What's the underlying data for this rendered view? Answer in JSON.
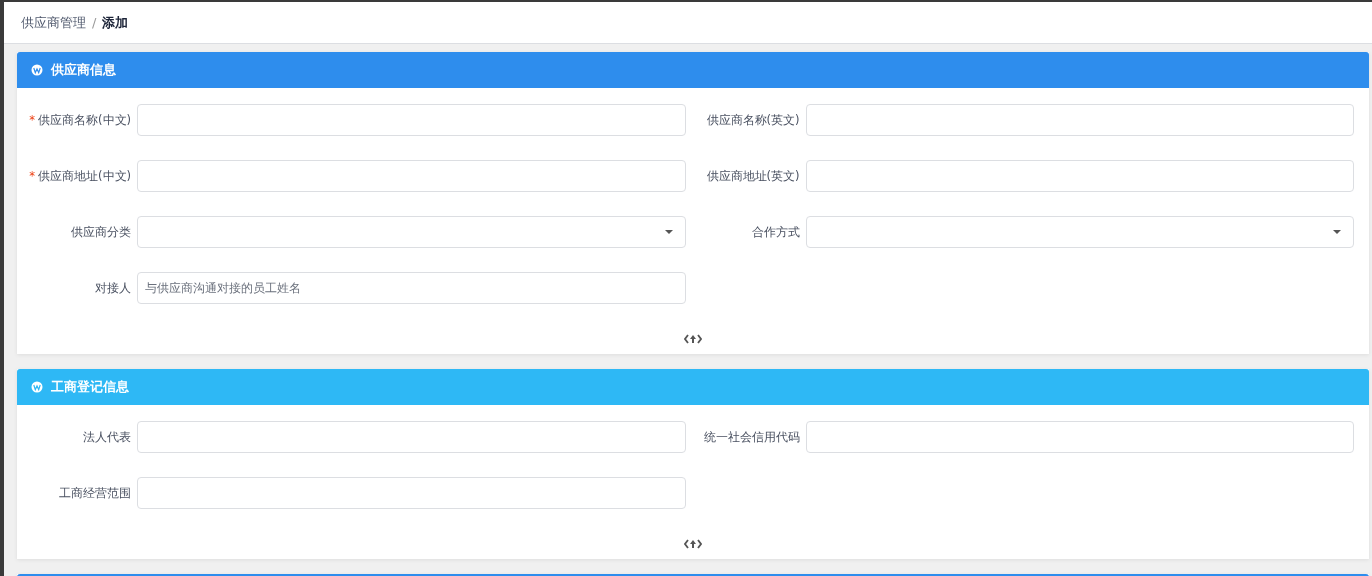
{
  "breadcrumb_separator": "/",
  "required_mark": "*",
  "breadcrumb": [
    {
      "label": "供应商管理",
      "current": false
    },
    {
      "label": "添加",
      "current": true
    }
  ],
  "sections": [
    {
      "title": "供应商信息",
      "color": "#2e8ded",
      "fields": [
        {
          "label": "供应商名称(中文)",
          "required": true,
          "kind": "text"
        },
        {
          "label": "供应商名称(英文)",
          "required": false,
          "kind": "text"
        },
        {
          "label": "供应商地址(中文)",
          "required": true,
          "kind": "text"
        },
        {
          "label": "供应商地址(英文)",
          "required": false,
          "kind": "text"
        },
        {
          "label": "供应商分类",
          "required": false,
          "kind": "select"
        },
        {
          "label": "合作方式",
          "required": false,
          "kind": "select"
        },
        {
          "label": "对接人",
          "required": false,
          "kind": "text",
          "placeholder": "与供应商沟通对接的员工姓名"
        }
      ]
    },
    {
      "title": "工商登记信息",
      "color": "#2eb8f5",
      "fields": [
        {
          "label": "法人代表",
          "required": false,
          "kind": "text"
        },
        {
          "label": "统一社会信用代码",
          "required": false,
          "kind": "text"
        },
        {
          "label": "工商经营范围",
          "required": false,
          "kind": "text"
        }
      ]
    },
    {
      "color": "#2e8ded"
    }
  ]
}
